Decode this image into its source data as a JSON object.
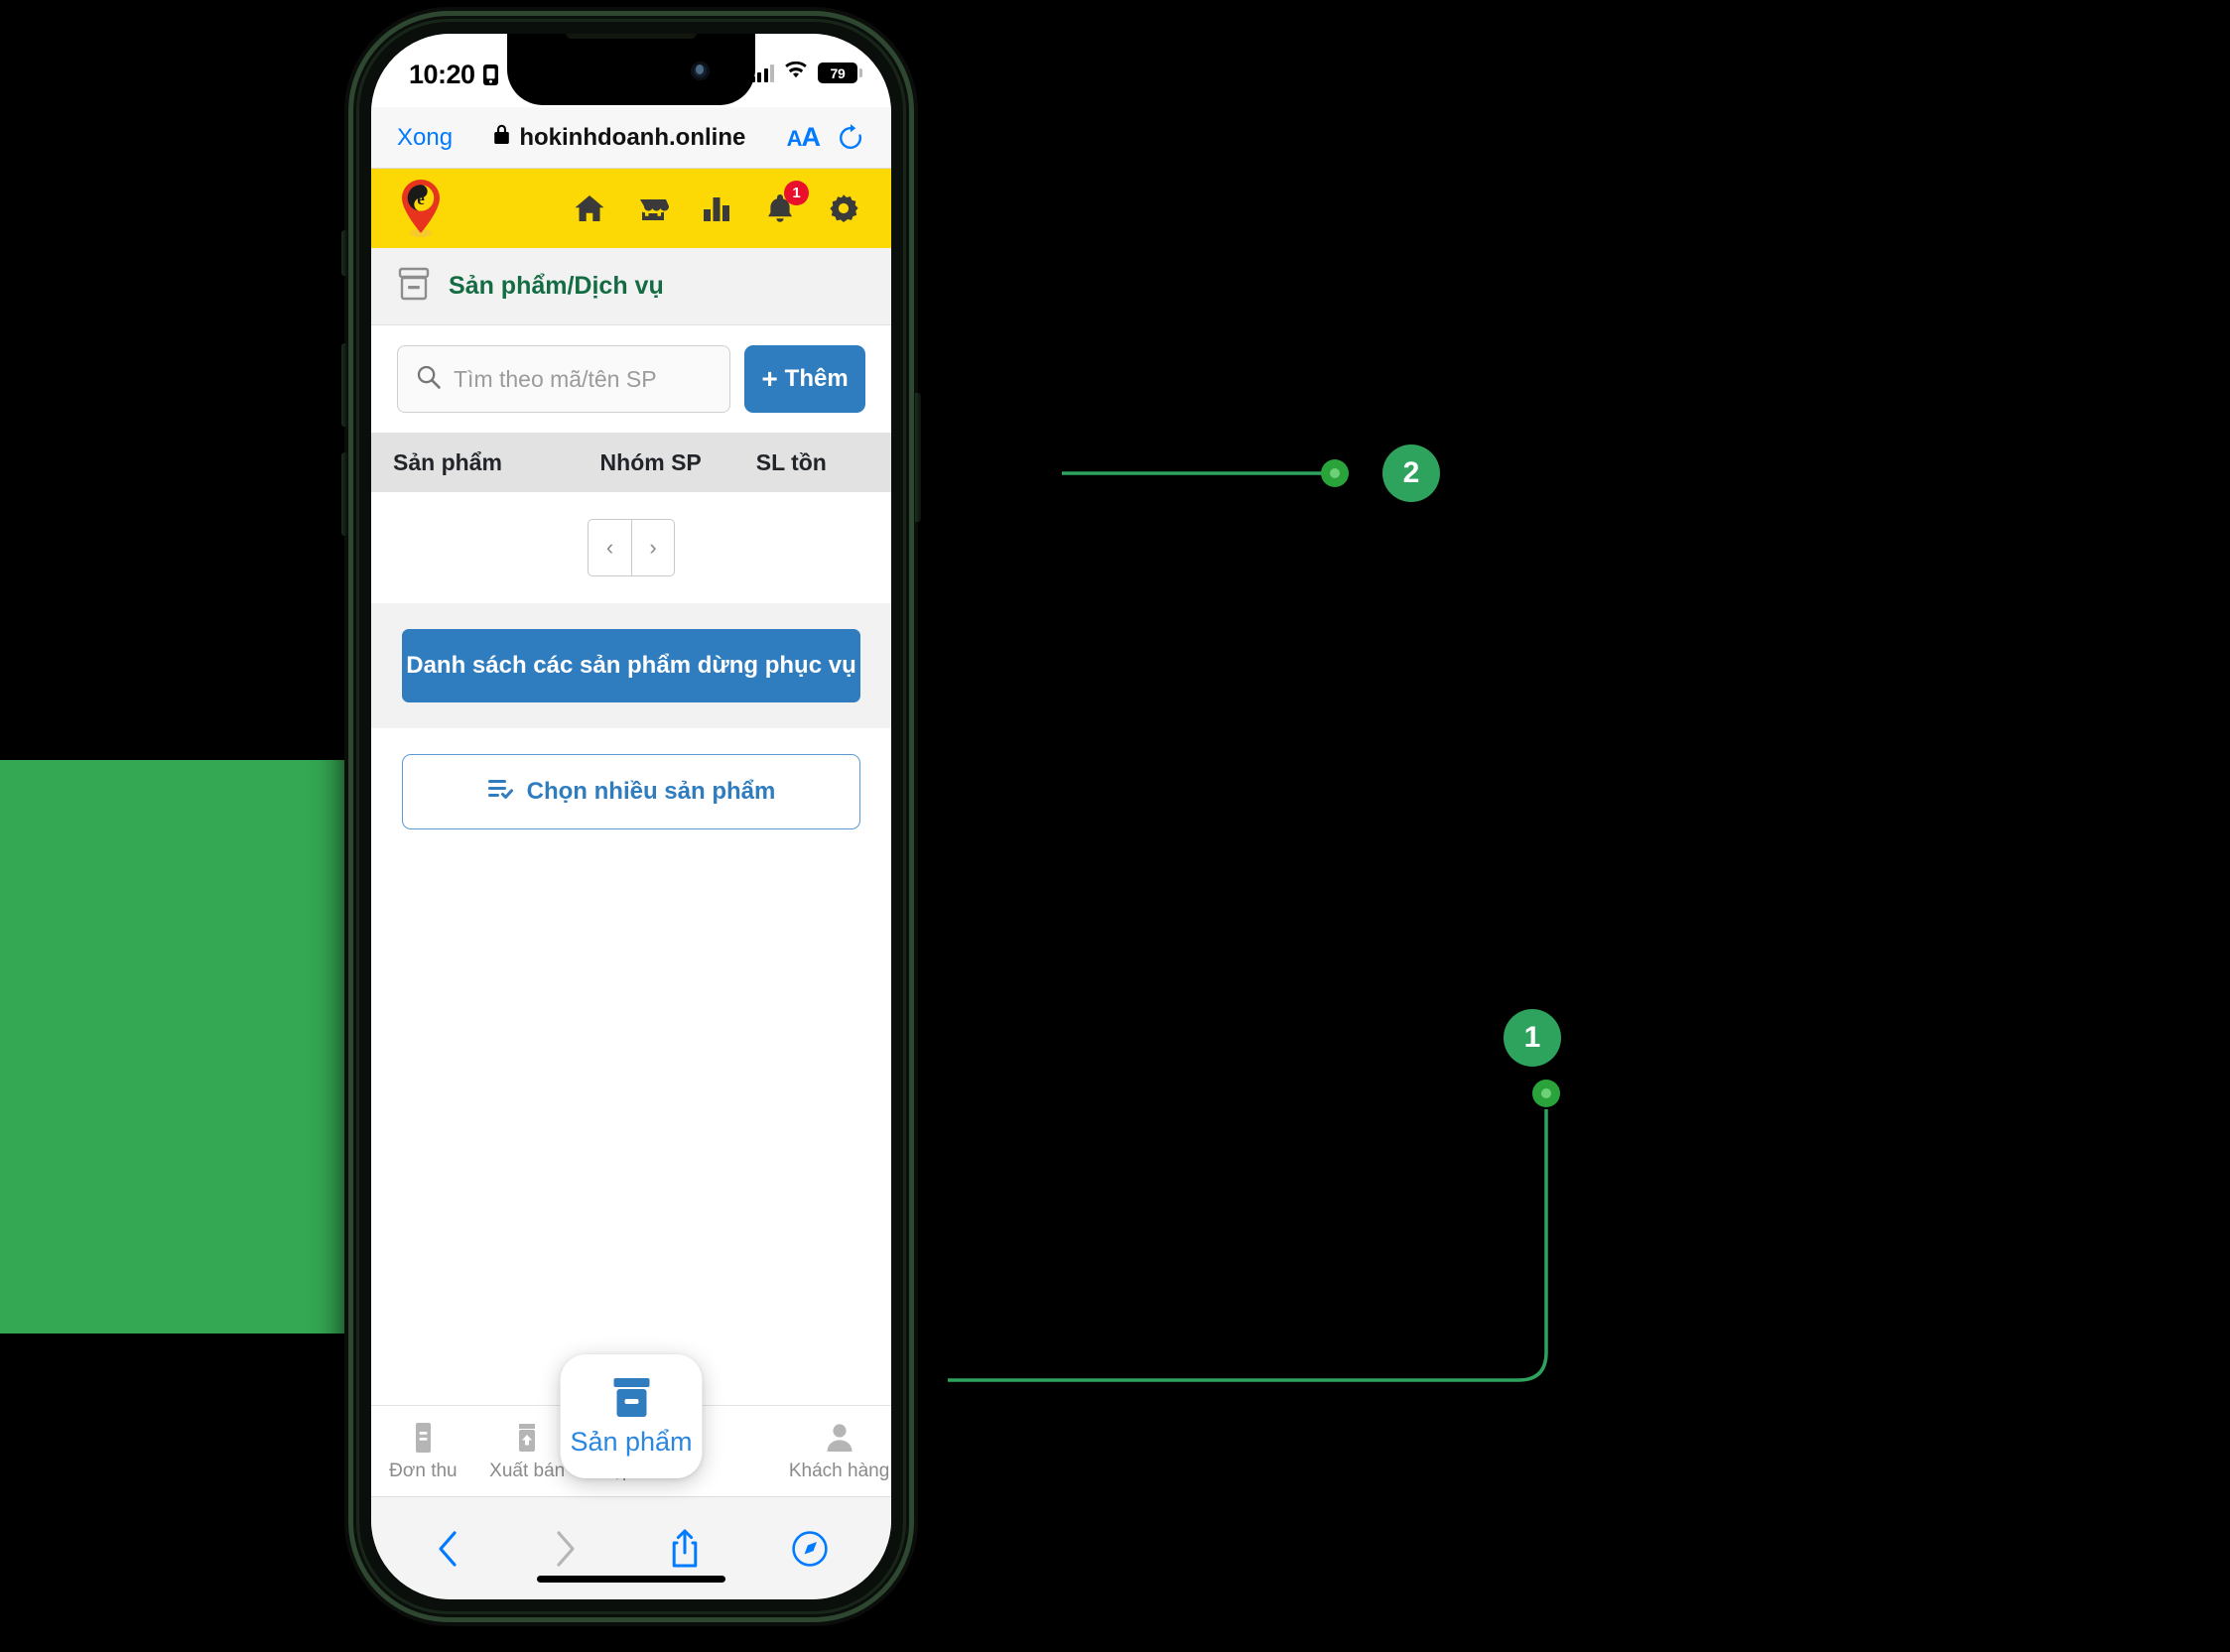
{
  "status_bar": {
    "time": "10:20",
    "lock_icon": "locked-portrait-icon",
    "signal_icon": "cellular-signal-icon",
    "wifi_icon": "wifi-icon",
    "battery_level": "79"
  },
  "browser": {
    "done_label": "Xong",
    "lock_icon": "padlock-icon",
    "url": "hokinhdoanh.online",
    "text_size_label_small": "A",
    "text_size_label_large": "A",
    "reload_icon": "reload-icon",
    "toolbar": {
      "back_icon": "chevron-left-icon",
      "forward_icon": "chevron-right-icon",
      "share_icon": "share-icon",
      "tabs_icon": "compass-icon"
    }
  },
  "app_header": {
    "logo_icon": "map-pin-e-logo",
    "accent_color": "#fcd905",
    "icons": [
      {
        "name": "home-icon",
        "badge": ""
      },
      {
        "name": "store-icon",
        "badge": ""
      },
      {
        "name": "chart-bar-icon",
        "badge": ""
      },
      {
        "name": "bell-icon",
        "badge": "1"
      },
      {
        "name": "gear-icon",
        "badge": ""
      }
    ]
  },
  "page": {
    "title_icon": "archive-box-icon",
    "title": "Sản phẩm/Dịch vụ",
    "title_color": "#146c43"
  },
  "search": {
    "icon": "search-icon",
    "placeholder": "Tìm theo mã/tên SP",
    "value": "",
    "add_button": {
      "plus": "+",
      "label": "Thêm",
      "color": "#2f7cbf"
    }
  },
  "table": {
    "columns": [
      "Sản phẩm",
      "Nhóm SP",
      "SL tồn"
    ],
    "rows": []
  },
  "pagination": {
    "prev": "‹",
    "next": "›"
  },
  "actions": {
    "stopped_products_label": "Danh sách các sản phẩm dừng phục vụ",
    "multi_select_icon": "list-check-icon",
    "multi_select_label": "Chọn nhiều sản phẩm"
  },
  "bottom_tabs": [
    {
      "label": "Đơn thu",
      "icon": "receipt-icon",
      "active": false
    },
    {
      "label": "Xuất bán",
      "icon": "box-arrow-up-icon",
      "active": false
    },
    {
      "label": "Nhập mua",
      "icon": "box-arrow-down-icon",
      "active": false
    },
    {
      "label": "Sản phẩm",
      "icon": "archive-box-icon",
      "active": true
    },
    {
      "label": "Khách hàng",
      "icon": "person-icon",
      "active": false
    }
  ],
  "annotations": [
    {
      "number": "1",
      "target": "bottom-tab-san-pham",
      "color": "#2ea35e"
    },
    {
      "number": "2",
      "target": "add-product-button",
      "color": "#2ea35e"
    }
  ]
}
